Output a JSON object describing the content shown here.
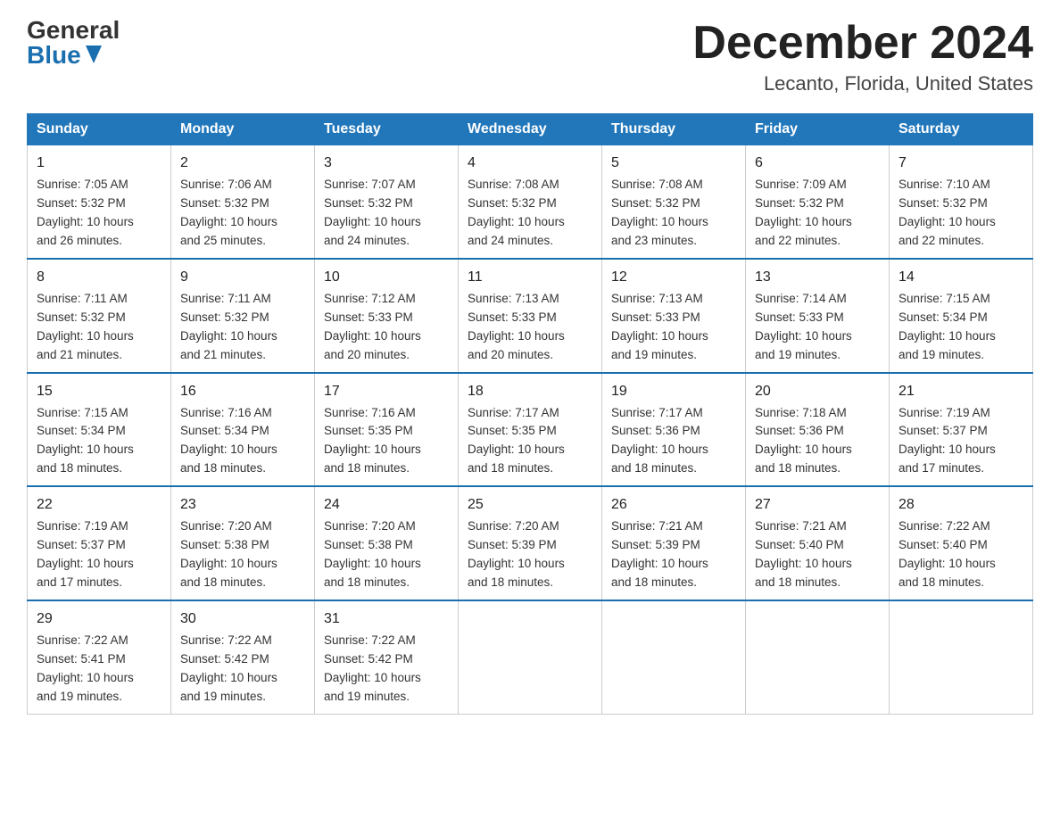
{
  "header": {
    "logo_general": "General",
    "logo_blue": "Blue",
    "month_title": "December 2024",
    "location": "Lecanto, Florida, United States"
  },
  "days_of_week": [
    "Sunday",
    "Monday",
    "Tuesday",
    "Wednesday",
    "Thursday",
    "Friday",
    "Saturday"
  ],
  "weeks": [
    [
      {
        "day": "1",
        "sunrise": "7:05 AM",
        "sunset": "5:32 PM",
        "daylight": "10 hours and 26 minutes."
      },
      {
        "day": "2",
        "sunrise": "7:06 AM",
        "sunset": "5:32 PM",
        "daylight": "10 hours and 25 minutes."
      },
      {
        "day": "3",
        "sunrise": "7:07 AM",
        "sunset": "5:32 PM",
        "daylight": "10 hours and 24 minutes."
      },
      {
        "day": "4",
        "sunrise": "7:08 AM",
        "sunset": "5:32 PM",
        "daylight": "10 hours and 24 minutes."
      },
      {
        "day": "5",
        "sunrise": "7:08 AM",
        "sunset": "5:32 PM",
        "daylight": "10 hours and 23 minutes."
      },
      {
        "day": "6",
        "sunrise": "7:09 AM",
        "sunset": "5:32 PM",
        "daylight": "10 hours and 22 minutes."
      },
      {
        "day": "7",
        "sunrise": "7:10 AM",
        "sunset": "5:32 PM",
        "daylight": "10 hours and 22 minutes."
      }
    ],
    [
      {
        "day": "8",
        "sunrise": "7:11 AM",
        "sunset": "5:32 PM",
        "daylight": "10 hours and 21 minutes."
      },
      {
        "day": "9",
        "sunrise": "7:11 AM",
        "sunset": "5:32 PM",
        "daylight": "10 hours and 21 minutes."
      },
      {
        "day": "10",
        "sunrise": "7:12 AM",
        "sunset": "5:33 PM",
        "daylight": "10 hours and 20 minutes."
      },
      {
        "day": "11",
        "sunrise": "7:13 AM",
        "sunset": "5:33 PM",
        "daylight": "10 hours and 20 minutes."
      },
      {
        "day": "12",
        "sunrise": "7:13 AM",
        "sunset": "5:33 PM",
        "daylight": "10 hours and 19 minutes."
      },
      {
        "day": "13",
        "sunrise": "7:14 AM",
        "sunset": "5:33 PM",
        "daylight": "10 hours and 19 minutes."
      },
      {
        "day": "14",
        "sunrise": "7:15 AM",
        "sunset": "5:34 PM",
        "daylight": "10 hours and 19 minutes."
      }
    ],
    [
      {
        "day": "15",
        "sunrise": "7:15 AM",
        "sunset": "5:34 PM",
        "daylight": "10 hours and 18 minutes."
      },
      {
        "day": "16",
        "sunrise": "7:16 AM",
        "sunset": "5:34 PM",
        "daylight": "10 hours and 18 minutes."
      },
      {
        "day": "17",
        "sunrise": "7:16 AM",
        "sunset": "5:35 PM",
        "daylight": "10 hours and 18 minutes."
      },
      {
        "day": "18",
        "sunrise": "7:17 AM",
        "sunset": "5:35 PM",
        "daylight": "10 hours and 18 minutes."
      },
      {
        "day": "19",
        "sunrise": "7:17 AM",
        "sunset": "5:36 PM",
        "daylight": "10 hours and 18 minutes."
      },
      {
        "day": "20",
        "sunrise": "7:18 AM",
        "sunset": "5:36 PM",
        "daylight": "10 hours and 18 minutes."
      },
      {
        "day": "21",
        "sunrise": "7:19 AM",
        "sunset": "5:37 PM",
        "daylight": "10 hours and 17 minutes."
      }
    ],
    [
      {
        "day": "22",
        "sunrise": "7:19 AM",
        "sunset": "5:37 PM",
        "daylight": "10 hours and 17 minutes."
      },
      {
        "day": "23",
        "sunrise": "7:20 AM",
        "sunset": "5:38 PM",
        "daylight": "10 hours and 18 minutes."
      },
      {
        "day": "24",
        "sunrise": "7:20 AM",
        "sunset": "5:38 PM",
        "daylight": "10 hours and 18 minutes."
      },
      {
        "day": "25",
        "sunrise": "7:20 AM",
        "sunset": "5:39 PM",
        "daylight": "10 hours and 18 minutes."
      },
      {
        "day": "26",
        "sunrise": "7:21 AM",
        "sunset": "5:39 PM",
        "daylight": "10 hours and 18 minutes."
      },
      {
        "day": "27",
        "sunrise": "7:21 AM",
        "sunset": "5:40 PM",
        "daylight": "10 hours and 18 minutes."
      },
      {
        "day": "28",
        "sunrise": "7:22 AM",
        "sunset": "5:40 PM",
        "daylight": "10 hours and 18 minutes."
      }
    ],
    [
      {
        "day": "29",
        "sunrise": "7:22 AM",
        "sunset": "5:41 PM",
        "daylight": "10 hours and 19 minutes."
      },
      {
        "day": "30",
        "sunrise": "7:22 AM",
        "sunset": "5:42 PM",
        "daylight": "10 hours and 19 minutes."
      },
      {
        "day": "31",
        "sunrise": "7:22 AM",
        "sunset": "5:42 PM",
        "daylight": "10 hours and 19 minutes."
      },
      null,
      null,
      null,
      null
    ]
  ],
  "labels": {
    "sunrise": "Sunrise:",
    "sunset": "Sunset:",
    "daylight": "Daylight:"
  }
}
